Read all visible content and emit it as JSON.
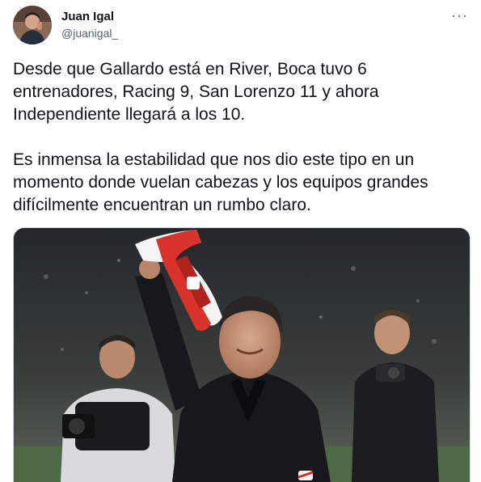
{
  "tweet": {
    "author_name": "Juan Igal",
    "author_handle": "@juanigal_",
    "more_icon": "more-horizontal-icon",
    "paragraphs": [
      "Desde que Gallardo está en River, Boca tuvo 6 entrenadores, Racing 9, San Lorenzo 11 y ahora Independiente llegará a los 10.",
      "Es inmensa la estabilidad que nos dio este tipo en un momento donde vuelan cabezas y los equipos grandes difícilmente encuentran un rumbo claro."
    ]
  },
  "colors": {
    "text_primary": "#0f1419",
    "text_secondary": "#536471",
    "media_border": "#cfd9de"
  }
}
